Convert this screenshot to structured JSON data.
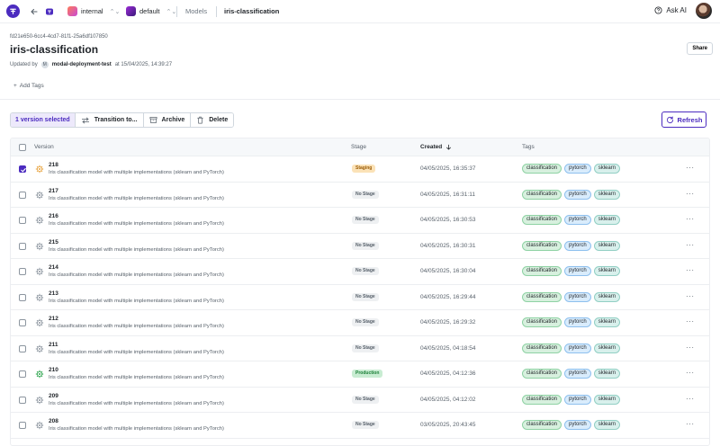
{
  "topbar": {
    "project": "internal",
    "workspace": "default",
    "breadcrumb_models": "Models",
    "breadcrumb_current": "iris-classification",
    "ask_ai": "Ask AI"
  },
  "header": {
    "model_id": "fd21e650-6cc4-4cd7-81f1-25a6df107850",
    "title": "iris-classification",
    "share": "Share",
    "updated_by_prefix": "Updated by",
    "updated_by_initial": "M",
    "updated_by_user": "modal-deployment-test",
    "updated_at": "at 15/04/2025, 14:39:27",
    "add_tags": "Add Tags"
  },
  "toolbar": {
    "selected": "1 version selected",
    "transition": "Transition to...",
    "archive": "Archive",
    "delete": "Delete",
    "refresh": "Refresh"
  },
  "table": {
    "col_version": "Version",
    "col_stage": "Stage",
    "col_created": "Created",
    "col_tags": "Tags",
    "rows": [
      {
        "version": "218",
        "desc": "Iris classification model with multiple implementations (sklearn and PyTorch)",
        "stage": "Staging",
        "stage_kind": "staging",
        "created": "04/05/2025, 16:35:37",
        "checked": true
      },
      {
        "version": "217",
        "desc": "Iris classification model with multiple implementations (sklearn and PyTorch)",
        "stage": "No Stage",
        "stage_kind": "nostage",
        "created": "04/05/2025, 16:31:11",
        "checked": false
      },
      {
        "version": "216",
        "desc": "Iris classification model with multiple implementations (sklearn and PyTorch)",
        "stage": "No Stage",
        "stage_kind": "nostage",
        "created": "04/05/2025, 16:30:53",
        "checked": false
      },
      {
        "version": "215",
        "desc": "Iris classification model with multiple implementations (sklearn and PyTorch)",
        "stage": "No Stage",
        "stage_kind": "nostage",
        "created": "04/05/2025, 16:30:31",
        "checked": false
      },
      {
        "version": "214",
        "desc": "Iris classification model with multiple implementations (sklearn and PyTorch)",
        "stage": "No Stage",
        "stage_kind": "nostage",
        "created": "04/05/2025, 16:30:04",
        "checked": false
      },
      {
        "version": "213",
        "desc": "Iris classification model with multiple implementations (sklearn and PyTorch)",
        "stage": "No Stage",
        "stage_kind": "nostage",
        "created": "04/05/2025, 16:29:44",
        "checked": false
      },
      {
        "version": "212",
        "desc": "Iris classification model with multiple implementations (sklearn and PyTorch)",
        "stage": "No Stage",
        "stage_kind": "nostage",
        "created": "04/05/2025, 16:29:32",
        "checked": false
      },
      {
        "version": "211",
        "desc": "Iris classification model with multiple implementations (sklearn and PyTorch)",
        "stage": "No Stage",
        "stage_kind": "nostage",
        "created": "04/05/2025, 04:18:54",
        "checked": false
      },
      {
        "version": "210",
        "desc": "Iris classification model with multiple implementations (sklearn and PyTorch)",
        "stage": "Production",
        "stage_kind": "production",
        "created": "04/05/2025, 04:12:36",
        "checked": false
      },
      {
        "version": "209",
        "desc": "Iris classification model with multiple implementations (sklearn and PyTorch)",
        "stage": "No Stage",
        "stage_kind": "nostage",
        "created": "04/05/2025, 04:12:02",
        "checked": false
      },
      {
        "version": "208",
        "desc": "Iris classification model with multiple implementations (sklearn and PyTorch)",
        "stage": "No Stage",
        "stage_kind": "nostage",
        "created": "03/05/2025, 20:43:45",
        "checked": false
      }
    ],
    "row_tags": [
      "classification",
      "pytorch",
      "sklearn"
    ],
    "more": "···"
  },
  "colors": {
    "accent": "#4b2bbf",
    "staging_icon": "#e8a33d",
    "production_icon": "#2da44e",
    "default_icon": "#8c959f"
  },
  "icons": [
    "app-logo-icon",
    "arrow-left-icon",
    "home-icon",
    "chevron-updown-icon",
    "help-circle-icon",
    "transition-icon",
    "archive-icon",
    "trash-icon",
    "refresh-icon",
    "sort-down-icon",
    "version-cog-icon"
  ]
}
